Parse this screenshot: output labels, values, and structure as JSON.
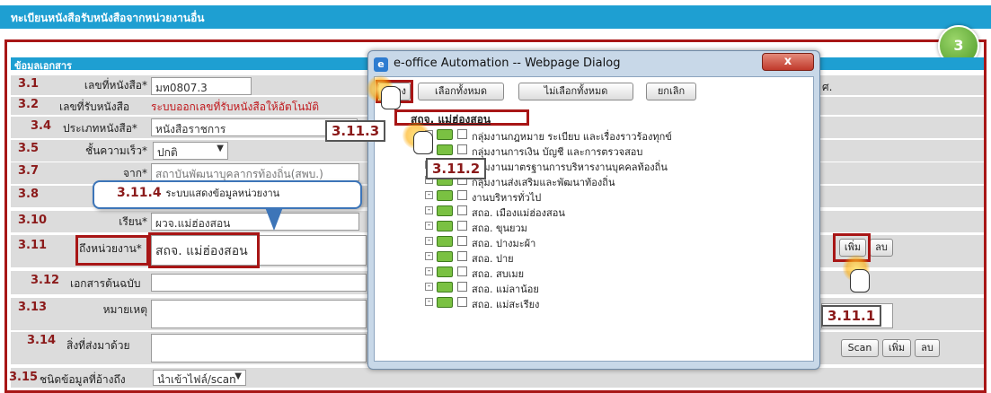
{
  "title": "ทะเบียนหนังสือรับหนังสือจากหน่วยงานอื่น",
  "step_badge": "3",
  "section": "ข้อมูลเอกสาร",
  "rows": [
    {
      "num": "3.1",
      "label": "เลขที่หนังสือ*",
      "value": "มท0807.3"
    },
    {
      "num": "3.2",
      "label": "เลขที่รับหนังสือ",
      "value": "ระบบออกเลขที่รับหนังสือให้อัตโนมัติ"
    },
    {
      "num": "3.4",
      "label": "ประเภทหนังสือ*",
      "value": "หนังสือราชการ"
    },
    {
      "num": "3.5",
      "label": "ชั้นความเร็ว*",
      "value": "ปกติ"
    },
    {
      "num": "3.7",
      "label": "จาก*",
      "value": "สถาบันพัฒนาบุคลากรท้องถิ่น(สพบ.)"
    },
    {
      "num": "3.8",
      "label": "",
      "value": ""
    },
    {
      "num": "3.10",
      "label": "เรียน*",
      "value": "ผวจ.แม่ฮ่องสอน"
    },
    {
      "num": "3.11",
      "label": "ถึงหน่วยงาน*",
      "value": "สถจ. แม่ฮ่องสอน"
    },
    {
      "num": "3.12",
      "label": "เอกสารต้นฉบับ",
      "value": ""
    },
    {
      "num": "3.13",
      "label": "หมายเหตุ",
      "value": ""
    },
    {
      "num": "3.14",
      "label": "สิ่งที่ส่งมาด้วย",
      "value": ""
    },
    {
      "num": "3.15",
      "label": "ชนิดข้อมูลที่อ้างถึง",
      "value": "นำเข้าไฟล์/scan"
    }
  ],
  "right_suffix": "ศ.",
  "buttons": {
    "add": "เพิ่ม",
    "delete": "ลบ",
    "scan": "Scan"
  },
  "dialog": {
    "title": "e-office Automation -- Webpage Dialog",
    "close": "x",
    "buttons": [
      "ตกลง",
      "เลือกทั้งหมด",
      "ไม่เลือกทั้งหมด",
      "ยกเลิก"
    ],
    "root": "สถจ. แม่ฮ่องสอน",
    "items": [
      "กลุ่มงานกฎหมาย ระเบียบ และเรื่องราวร้องทุกข์",
      "กลุ่มงานการเงิน บัญชี และการตรวจสอบ",
      "กลุ่มงานมาตรฐานการบริหารงานบุคคลท้องถิ่น",
      "กลุ่มงานส่งเสริมและพัฒนาท้องถิ่น",
      "งานบริหารทั่วไป",
      "สถอ. เมืองแม่ฮ่องสอน",
      "สถอ. ขุนยวม",
      "สถอ. ปางมะผ้า",
      "สถอ. ปาย",
      "สถอ. สบเมย",
      "สถอ. แม่ลาน้อย",
      "สถอ. แม่สะเรียง"
    ]
  },
  "annotations": {
    "s1": "3.11.1",
    "s2": "3.11.2",
    "s3": "3.11.3",
    "s4": "3.11.4",
    "s4_text": "ระบบแสดงข้อมูลหน่วยงาน"
  }
}
